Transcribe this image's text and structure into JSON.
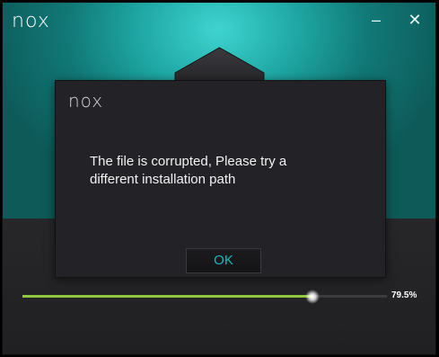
{
  "window": {
    "logo_text": "nox",
    "minimize_symbol": "–",
    "close_symbol": "✕"
  },
  "dialog": {
    "logo_text": "nox",
    "message_line1": "The file is corrupted, Please try a",
    "message_line2": "different installation path",
    "ok_label": "OK"
  },
  "progress": {
    "percent": 79.5,
    "label": "79.5%"
  },
  "colors": {
    "accent_teal": "#1ea6a3",
    "progress_green": "#8ec63f",
    "ok_text": "#1bb8b8"
  }
}
